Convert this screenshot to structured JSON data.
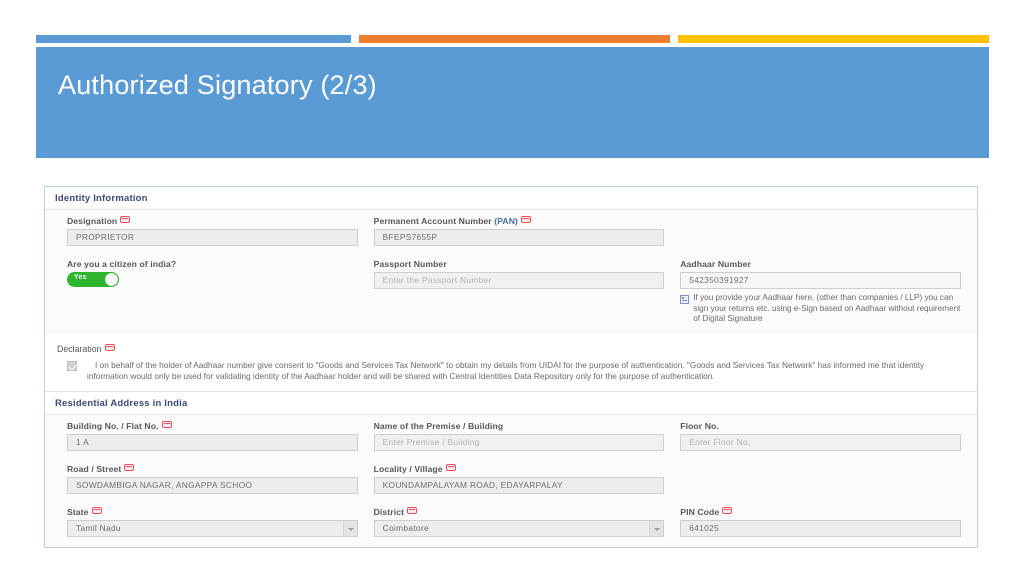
{
  "slide": {
    "title": "Authorized Signatory (2/3)",
    "accent_colors": [
      "#5B9BD5",
      "#ED7D31",
      "#FFC000"
    ],
    "banner_color": "#5B9BD5"
  },
  "form": {
    "sections": {
      "identity": {
        "heading": "Identity Information",
        "designation": {
          "label": "Designation",
          "value": "PROPRIETOR",
          "required": true
        },
        "pan": {
          "label": "Permanent Account Number",
          "label_sub": "(PAN)",
          "value": "BFEPS7655P",
          "required": true
        },
        "citizen": {
          "label": "Are you a citizen of india?",
          "toggle_value": "Yes"
        },
        "passport": {
          "label": "Passport Number",
          "value": "",
          "placeholder": "Enter the Passport Number"
        },
        "aadhaar": {
          "label": "Aadhaar Number",
          "value": "542350391927",
          "hint": "If you provide your Aadhaar here, (other than companies / LLP) you can sign your returns etc. using e-Sign based on Aadhaar without requirement of Digital Signature"
        }
      },
      "declaration": {
        "label": "Declaration",
        "required": true,
        "checked": true,
        "text": "I on behalf of the holder of Aadhaar number give consent to \"Goods and Services Tax Network\" to obtain my details from UIDAI for the purpose of authentication. \"Goods and Services Tax Network\" has informed me that identity information would only be used for validating identity of the Aadhaar holder and will be shared with Central Identities Data Repository only for the purpose of authentication."
      },
      "address": {
        "heading": "Residential Address in India",
        "building": {
          "label": "Building No. / Flat No.",
          "value": "1 A",
          "required": true
        },
        "premise": {
          "label": "Name of the Premise / Building",
          "value": "",
          "placeholder": "Enter Premise / Building"
        },
        "floor": {
          "label": "Floor No.",
          "value": "",
          "placeholder": "Enter Floor No."
        },
        "road": {
          "label": "Road / Street",
          "value": "SOWDAMBIGA NAGAR, ANGAPPA SCHOO",
          "required": true
        },
        "locality": {
          "label": "Locality / Village",
          "value": "KOUNDAMPALAYAM ROAD, EDAYARPALAY",
          "required": true
        },
        "state": {
          "label": "State",
          "value": "Tamil Nadu",
          "required": true
        },
        "district": {
          "label": "District",
          "value": "Coimbatore",
          "required": true
        },
        "pincode": {
          "label": "PIN Code",
          "value": "641025",
          "required": true
        }
      }
    }
  }
}
